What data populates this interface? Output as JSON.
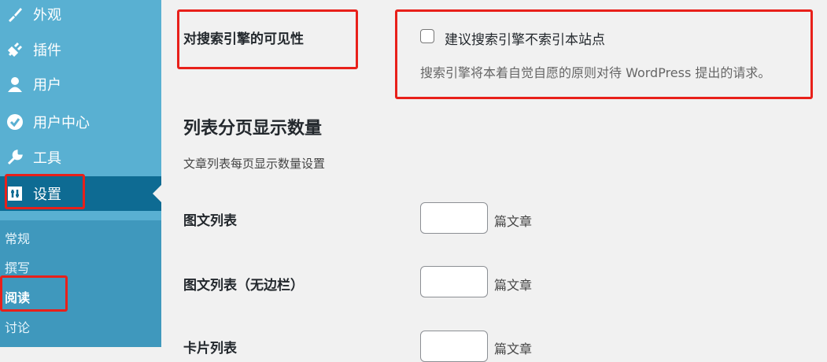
{
  "sidebar": {
    "items": [
      {
        "label": "外观",
        "icon": "paintbrush-icon"
      },
      {
        "label": "插件",
        "icon": "plugin-icon"
      },
      {
        "label": "用户",
        "icon": "user-icon"
      },
      {
        "label": "用户中心",
        "icon": "checkmark-circle-icon"
      },
      {
        "label": "工具",
        "icon": "wrench-icon"
      },
      {
        "label": "设置",
        "icon": "settings-icon"
      }
    ],
    "submenu": [
      "常规",
      "撰写",
      "阅读",
      "讨论"
    ]
  },
  "main": {
    "visibility": {
      "label": "对搜索引擎的可见性",
      "checkbox_label": "建议搜索引擎不索引本站点",
      "hint": "搜索引擎将本着自觉自愿的原则对待 WordPress 提出的请求。"
    },
    "pagination": {
      "title": "列表分页显示数量",
      "desc": "文章列表每页显示数量设置",
      "rows": [
        {
          "label": "图文列表",
          "unit": "篇文章"
        },
        {
          "label": "图文列表（无边栏）",
          "unit": "篇文章"
        },
        {
          "label": "卡片列表",
          "unit": "篇文章"
        }
      ]
    }
  },
  "colors": {
    "sidebar": "#59b0d2",
    "sidebar_active": "#0e6b93",
    "highlight": "#e8201a"
  }
}
